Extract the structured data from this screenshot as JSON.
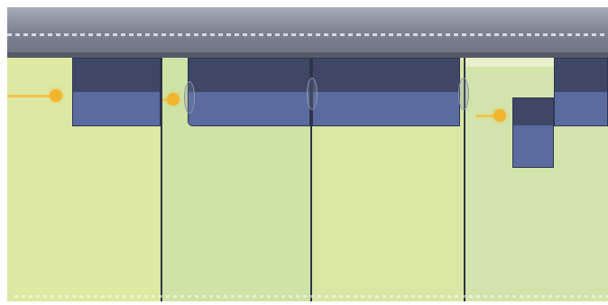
{
  "timeline": {
    "ruler": {
      "icon": "ruler-icon"
    },
    "lanes": [
      {
        "color": "#dde8a2"
      },
      {
        "color": "#cfe3a6"
      },
      {
        "color": "#d9e7a4"
      },
      {
        "color": "#d2e4ab"
      }
    ],
    "clips": [
      {
        "color_top": "#3e4866",
        "color_bottom": "#5a6ba0"
      },
      {
        "color_top": "#3e4866",
        "color_bottom": "#5a6ba0"
      },
      {
        "color_top": "#3e4866",
        "color_bottom": "#5a6ba0"
      },
      {
        "color_top": "#3e4866",
        "color_bottom": "#5a6ba0"
      },
      {
        "color_top": "#3e4866",
        "color_bottom": "#5a6ba0"
      }
    ],
    "markers": [
      {
        "icon": "playhead-arrow-icon",
        "color": "#f1b52d"
      },
      {
        "icon": "playhead-arrow-icon",
        "color": "#f1b52d"
      },
      {
        "icon": "playhead-arrow-icon",
        "color": "#f1b52d"
      }
    ]
  }
}
